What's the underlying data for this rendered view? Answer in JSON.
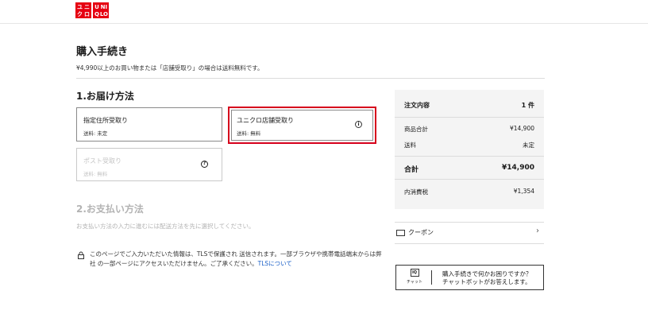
{
  "logo": {
    "left_block": [
      "ユ",
      "ニ",
      "ク",
      "ロ"
    ],
    "right_block": [
      "U",
      "NI",
      "Q",
      "LO"
    ]
  },
  "page": {
    "title": "購入手続き",
    "shipping_note": "¥4,990以上のお買い物または「店舗受取り」の場合は送料無料です。"
  },
  "delivery": {
    "title": "1.お届け方法",
    "options": [
      {
        "name": "指定住所受取り",
        "fee": "送料: 未定"
      },
      {
        "name": "ユニクロ店舗受取り",
        "fee": "送料: 無料",
        "icon": "info-icon"
      },
      {
        "name": "ポスト受取り",
        "fee": "送料: 無料",
        "icon": "help-icon"
      }
    ]
  },
  "payment": {
    "title": "2.お支払い方法",
    "note": "お支払い方法の入力に進むには配送方法を先に選択してください。"
  },
  "security": {
    "text": "このページでご入力いただいた情報は、TLSで保護され 送信されます。一部ブラウザや携帯電話端末からは弊社 の一部ページにアクセスいただけません。ご了承ください。",
    "link": "TLSについて"
  },
  "summary": {
    "header_label": "注文内容",
    "header_count": "1 件",
    "rows": [
      {
        "label": "商品合計",
        "value": "¥14,900"
      },
      {
        "label": "送料",
        "value": "未定"
      }
    ],
    "total_label": "合計",
    "total_value": "¥14,900",
    "tax_label": "内消費税",
    "tax_value": "¥1,354"
  },
  "coupon": {
    "label": "クーポン"
  },
  "chat": {
    "icon_text": "IQ",
    "icon_caption": "チャット",
    "line1": "購入手続きで何かお困りですか？",
    "line2": "チャットボットがお答えします。"
  },
  "colors": {
    "brand": "#e60012",
    "selected_border": "#d6001c",
    "link": "#1a5fc7"
  }
}
